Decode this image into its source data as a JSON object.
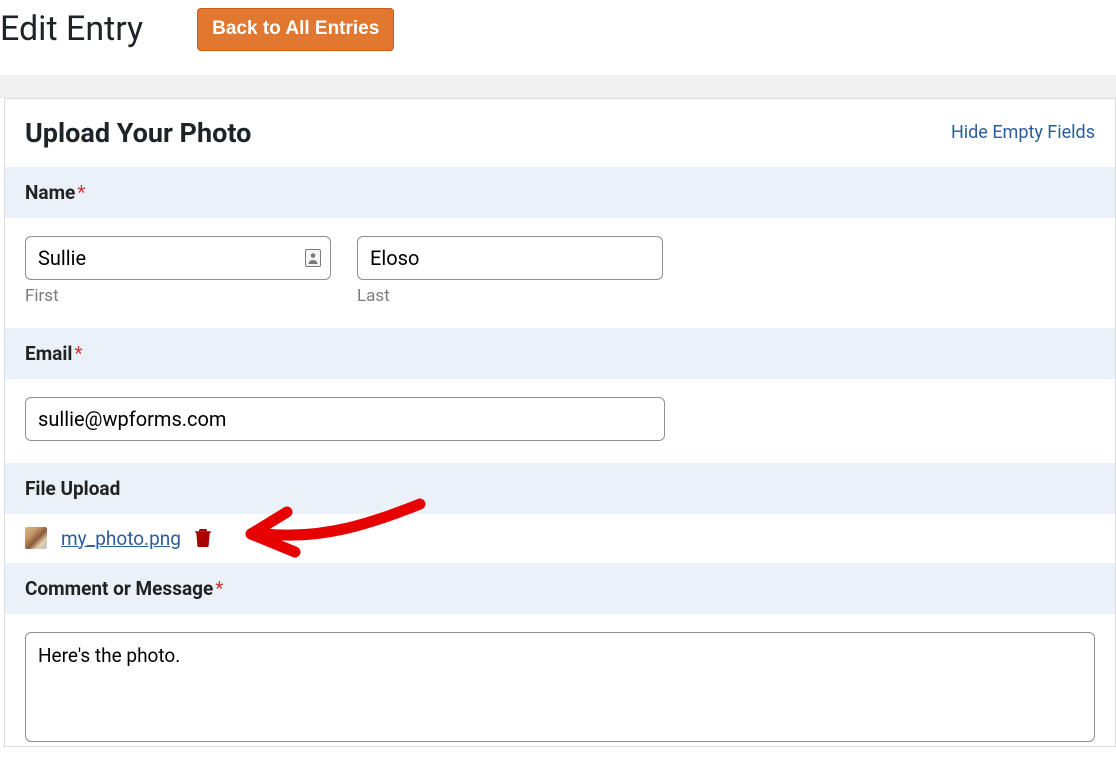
{
  "header": {
    "page_title": "Edit Entry",
    "back_button": "Back to All Entries"
  },
  "panel": {
    "title": "Upload Your Photo",
    "hide_link": "Hide Empty Fields"
  },
  "fields": {
    "name": {
      "label": "Name",
      "first_value": "Sullie",
      "first_sublabel": "First",
      "last_value": "Eloso",
      "last_sublabel": "Last"
    },
    "email": {
      "label": "Email",
      "value": "sullie@wpforms.com"
    },
    "file_upload": {
      "label": "File Upload",
      "filename": "my_photo.png"
    },
    "comment": {
      "label": "Comment or Message",
      "value": "Here's the photo."
    }
  }
}
